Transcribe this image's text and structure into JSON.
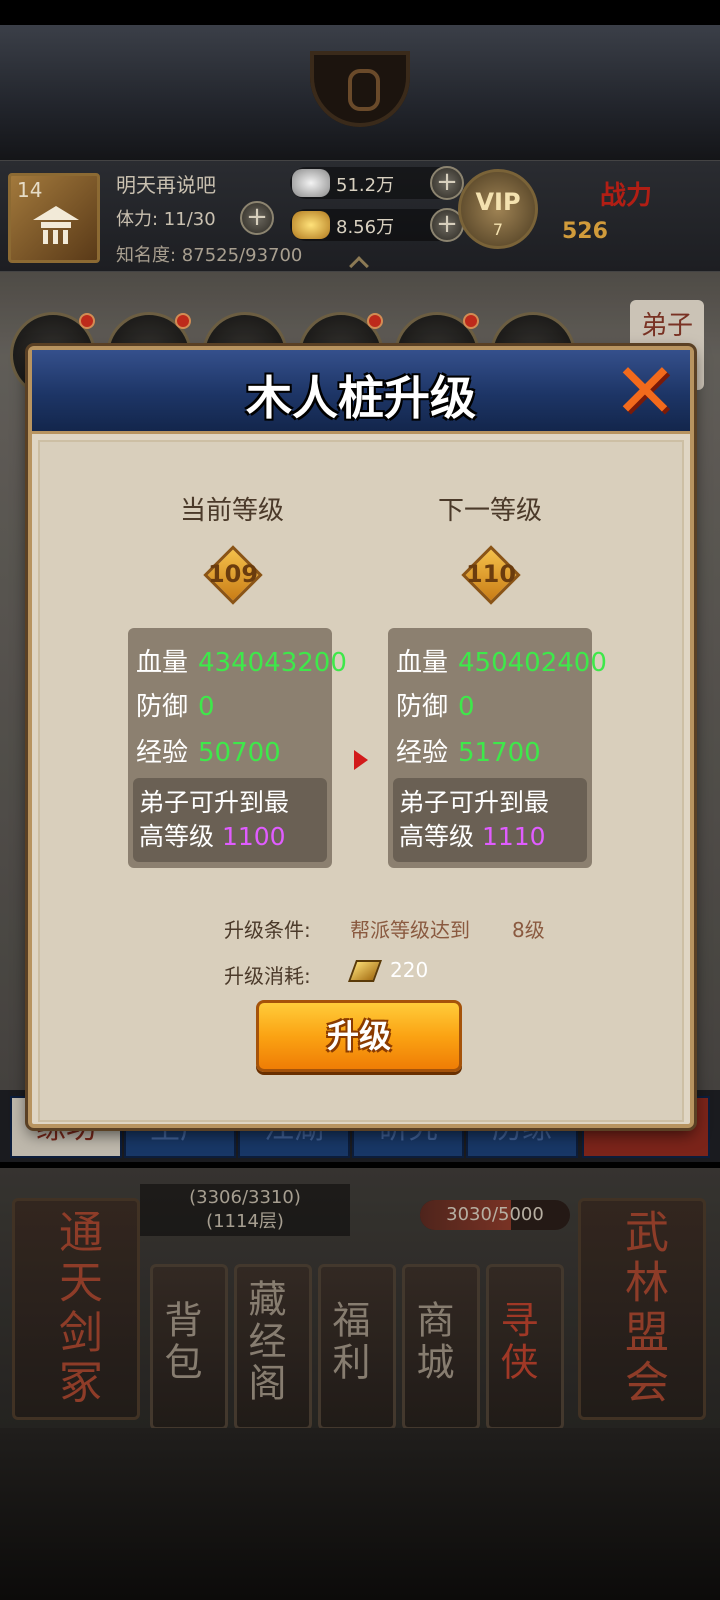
{
  "player": {
    "level": "14",
    "name": "明天再说吧",
    "stamina": "体力: 11/30",
    "fame": "知名度: 87525/93700",
    "silver": "51.2万",
    "gold": "8.56万",
    "vip_label": "VIP",
    "vip_level": "7",
    "power_label": "战力",
    "power_value": "526"
  },
  "side_tab": "弟子",
  "tabs": [
    "练功",
    "生产",
    "江湖",
    "研究",
    "历练"
  ],
  "bottom": {
    "left_big": "通天剑冢",
    "right_big": "武林盟会",
    "progress_a_line1": "(3306/3310)",
    "progress_a_line2": "(1114层)",
    "progress_b": "3030/5000",
    "progress_b_fraction": 0.606,
    "buttons": [
      "背包",
      "藏经阁",
      "福利",
      "商城",
      "寻侠"
    ]
  },
  "dialog": {
    "title": "木人桩升级",
    "current_header": "当前等级",
    "next_header": "下一等级",
    "current_level": "109",
    "next_level": "110",
    "current": {
      "hp_label": "血量",
      "hp": "434043200",
      "def_label": "防御",
      "def": "0",
      "exp_label": "经验",
      "exp": "50700",
      "max_text_1": "弟子可升到最",
      "max_text_2": "高等级",
      "max_level": "1100"
    },
    "next": {
      "hp_label": "血量",
      "hp": "450402400",
      "def_label": "防御",
      "def": "0",
      "exp_label": "经验",
      "exp": "51700",
      "max_text_1": "弟子可升到最",
      "max_text_2": "高等级",
      "max_level": "1110"
    },
    "condition_label": "升级条件:",
    "condition_text": "帮派等级达到",
    "condition_level": "8级",
    "cost_label": "升级消耗:",
    "cost_value": "220",
    "upgrade_button": "升级"
  },
  "colors": {
    "stat_value": "#3ee84a",
    "max_level": "#e05cff",
    "header_blue": "#1d3566",
    "button_orange": "#fba313"
  }
}
